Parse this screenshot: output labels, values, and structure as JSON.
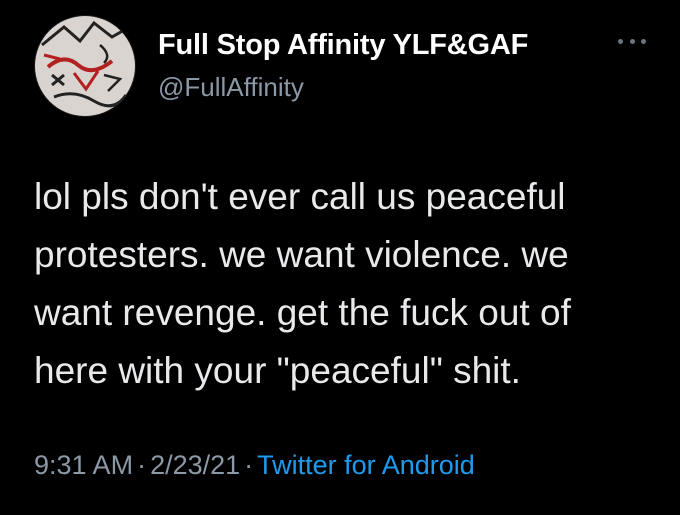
{
  "user": {
    "display_name": "Full Stop Affinity YLF&GAF",
    "handle": "@FullAffinity"
  },
  "tweet": {
    "lines": [
      "lol pls don't ever call us peaceful",
      "protesters. we want violence. we",
      "want revenge. get the fuck out of",
      "here with your \"peaceful\" shit."
    ],
    "time": "9:31 AM",
    "date": "2/23/21",
    "separator": "·",
    "source": "Twitter for Android"
  },
  "icons": {
    "more": "more-options-icon",
    "avatar": "avatar-image"
  },
  "colors": {
    "background": "#000000",
    "text": "#e7e9ea",
    "muted": "#8b98a5",
    "link": "#1d9bf0"
  }
}
